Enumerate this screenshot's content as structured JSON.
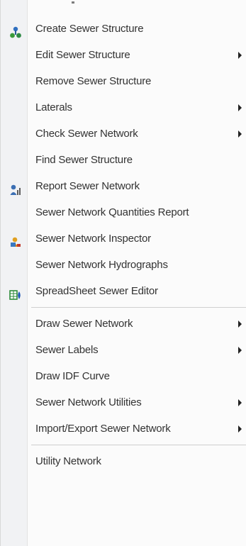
{
  "menu": {
    "items": [
      {
        "label": "Create Sewer Structure",
        "icon": "sewer-structure-icon"
      },
      {
        "label": "Edit Sewer Structure",
        "submenu": true
      },
      {
        "label": "Remove Sewer Structure"
      },
      {
        "label": "Laterals",
        "submenu": true
      },
      {
        "label": "Check Sewer Network",
        "submenu": true
      },
      {
        "label": "Find Sewer Structure"
      },
      {
        "label": "Report Sewer Network",
        "icon": "report-icon"
      },
      {
        "label": "Sewer Network Quantities Report"
      },
      {
        "label": "Sewer Network Inspector",
        "icon": "inspector-icon"
      },
      {
        "label": "Sewer Network Hydrographs"
      },
      {
        "label": "SpreadSheet Sewer Editor",
        "icon": "spreadsheet-icon"
      },
      {
        "label": "Draw Sewer Network",
        "submenu": true
      },
      {
        "label": "Sewer Labels",
        "submenu": true
      },
      {
        "label": "Draw IDF Curve"
      },
      {
        "label": "Sewer Network Utilities",
        "submenu": true
      },
      {
        "label": "Import/Export Sewer Network",
        "submenu": true
      },
      {
        "label": "Utility Network"
      }
    ]
  },
  "colors": {
    "text": "#333333",
    "gutter": "#f1f2f4",
    "separator": "#cfcfcf",
    "menu_bg": "#fbfbfb"
  }
}
